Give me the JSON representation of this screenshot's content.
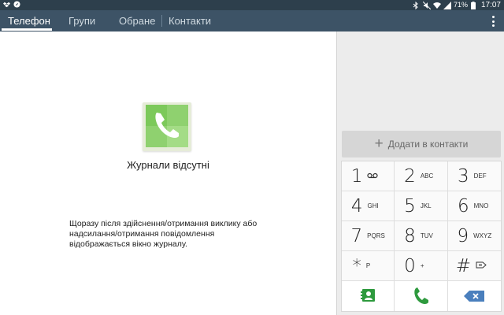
{
  "status_bar": {
    "left_icons": [
      "dropbox-icon",
      "compass-icon"
    ],
    "battery": "71%",
    "time": "17:07"
  },
  "tabs": [
    {
      "label": "Телефон",
      "active": true
    },
    {
      "label": "Групи",
      "active": false
    },
    {
      "label": "Обране",
      "active": false
    },
    {
      "label": "Контакти",
      "active": false
    }
  ],
  "log": {
    "empty_title": "Журнали відсутні",
    "empty_description": "Щоразу після здійснення/отримання виклику або\nнадсилання/отримання повідомлення\nвідображається вікно журналу."
  },
  "dialer": {
    "add_to_contacts": "Додати в контакти",
    "keys": [
      {
        "num": "1",
        "letters": ""
      },
      {
        "num": "2",
        "letters": "ABC"
      },
      {
        "num": "3",
        "letters": "DEF"
      },
      {
        "num": "4",
        "letters": "GHI"
      },
      {
        "num": "5",
        "letters": "JKL"
      },
      {
        "num": "6",
        "letters": "MNO"
      },
      {
        "num": "7",
        "letters": "PQRS"
      },
      {
        "num": "8",
        "letters": "TUV"
      },
      {
        "num": "9",
        "letters": "WXYZ"
      },
      {
        "num": "*",
        "letters": "P"
      },
      {
        "num": "0",
        "letters": "+"
      },
      {
        "num": "#",
        "letters": ""
      }
    ]
  },
  "colors": {
    "status_bar": "#2d3f4c",
    "app_bar": "#3d5366",
    "call_green": "#2e9a3e",
    "delete_blue": "#4a7fbd"
  }
}
